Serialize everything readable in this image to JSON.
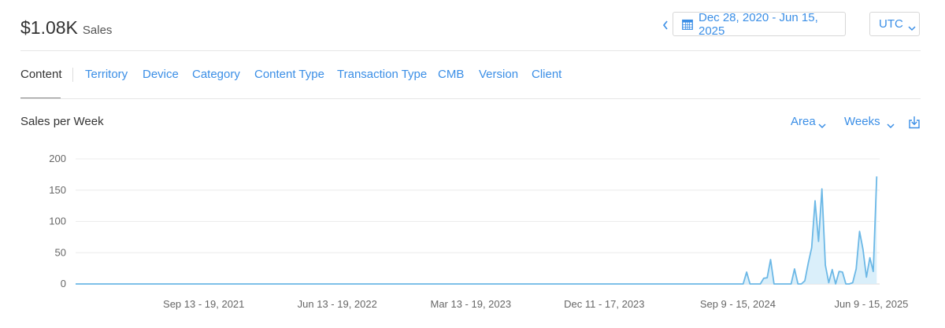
{
  "header": {
    "total_value": "$1.08K",
    "total_label": "Sales",
    "date_range": "Dec 28, 2020 - Jun 15, 2025",
    "timezone": "UTC"
  },
  "tabs": [
    {
      "label": "Content",
      "active": true
    },
    {
      "label": "Territory"
    },
    {
      "label": "Device"
    },
    {
      "label": "Category"
    },
    {
      "label": "Content Type"
    },
    {
      "label": "Transaction Type"
    },
    {
      "label": "CMB"
    },
    {
      "label": "Version"
    },
    {
      "label": "Client"
    }
  ],
  "chart_header": {
    "title": "Sales per Week",
    "chart_type_label": "Area",
    "interval_label": "Weeks"
  },
  "icons": [
    "chevron-left-icon",
    "calendar-icon",
    "chevron-down-icon",
    "download-icon"
  ],
  "colors": {
    "accent": "#3a8ee6",
    "area_line": "#6cb8e6",
    "area_fill": "#d4ecf9"
  },
  "chart_data": {
    "type": "area",
    "title": "Sales per Week",
    "ylim": [
      0,
      200
    ],
    "yticks": [
      0,
      50,
      100,
      150,
      200
    ],
    "x_start_week": "Dec 28, 2020",
    "x_end_week": "Jun 15, 2025",
    "xtick_labels": [
      "Sep 13 - 19, 2021",
      "Jun 13 - 19, 2022",
      "Mar 13 - 19, 2023",
      "Dec 11 - 17, 2023",
      "Sep 9 - 15, 2024",
      "Jun 9 - 15, 2025"
    ],
    "nonzero_weeks": [
      {
        "week": "Sep 30 - Oct 6, 2024",
        "value": 19
      },
      {
        "week": "Oct 7 - 13, 2024",
        "value": 0
      },
      {
        "week": "Nov 4 - 10, 2024",
        "value": 9
      },
      {
        "week": "Nov 11 - 17, 2024",
        "value": 10
      },
      {
        "week": "Nov 18 - 24, 2024",
        "value": 39
      },
      {
        "week": "Nov 25 - Dec 1, 2024",
        "value": 0
      },
      {
        "week": "Jan 6 - 12, 2025",
        "value": 24
      },
      {
        "week": "Jan 13 - 19, 2025",
        "value": 0
      },
      {
        "week": "Jan 27 - Feb 2, 2025",
        "value": 5
      },
      {
        "week": "Feb 3 - 9, 2025",
        "value": 33
      },
      {
        "week": "Feb 10 - 16, 2025",
        "value": 58
      },
      {
        "week": "Feb 17 - 23, 2025",
        "value": 133
      },
      {
        "week": "Feb 24 - Mar 2, 2025",
        "value": 68
      },
      {
        "week": "Mar 3 - 9, 2025",
        "value": 152
      },
      {
        "week": "Mar 10 - 16, 2025",
        "value": 30
      },
      {
        "week": "Mar 17 - 23, 2025",
        "value": 2
      },
      {
        "week": "Mar 24 - 30, 2025",
        "value": 23
      },
      {
        "week": "Mar 31 - Apr 6, 2025",
        "value": 0
      },
      {
        "week": "Apr 7 - 13, 2025",
        "value": 20
      },
      {
        "week": "Apr 14 - 20, 2025",
        "value": 19
      },
      {
        "week": "Apr 21 - 27, 2025",
        "value": 0
      },
      {
        "week": "May 5 - 11, 2025",
        "value": 2
      },
      {
        "week": "May 12 - 18, 2025",
        "value": 24
      },
      {
        "week": "May 19 - 25, 2025",
        "value": 84
      },
      {
        "week": "May 26 - Jun 1, 2025",
        "value": 55
      },
      {
        "week": "Jun 2 - 8, 2025",
        "value": 11
      },
      {
        "week": "Jun 9 - 15, 2025",
        "value": 42
      },
      {
        "week": "Jun 16 - 22, 2025",
        "value": 20
      },
      {
        "week": "Jun 23 - 29, 2025",
        "value": 172
      }
    ]
  }
}
